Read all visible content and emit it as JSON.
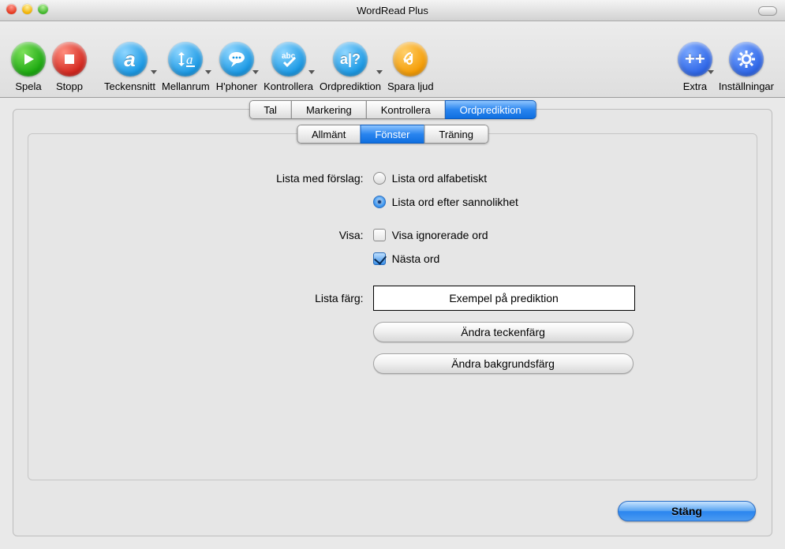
{
  "window": {
    "title": "WordRead Plus"
  },
  "toolbar": {
    "play": {
      "label": "Spela"
    },
    "stop": {
      "label": "Stopp"
    },
    "font": {
      "label": "Teckensnitt"
    },
    "spacing": {
      "label": "Mellanrum"
    },
    "homoph": {
      "label": "H'phoner"
    },
    "check": {
      "label": "Kontrollera"
    },
    "predict": {
      "label": "Ordprediktion"
    },
    "save": {
      "label": "Spara ljud"
    },
    "extra": {
      "label": "Extra"
    },
    "settings": {
      "label": "Inställningar"
    }
  },
  "tabs": {
    "main": [
      "Tal",
      "Markering",
      "Kontrollera",
      "Ordprediktion"
    ],
    "main_selected": 3,
    "sub": [
      "Allmänt",
      "Fönster",
      "Träning"
    ],
    "sub_selected": 1
  },
  "form": {
    "list_label": "Lista med förslag:",
    "list_alpha": "Lista ord alfabetiskt",
    "list_prob": "Lista ord efter sannolikhet",
    "list_sel": "prob",
    "show_label": "Visa:",
    "show_ignored": "Visa ignorerade ord",
    "show_ignored_checked": false,
    "next_word": "Nästa ord",
    "next_word_checked": true,
    "color_label": "Lista färg:",
    "example": "Exempel på prediktion",
    "btn_fg": "Ändra teckenfärg",
    "btn_bg": "Ändra bakgrundsfärg"
  },
  "buttons": {
    "close": "Stäng"
  }
}
